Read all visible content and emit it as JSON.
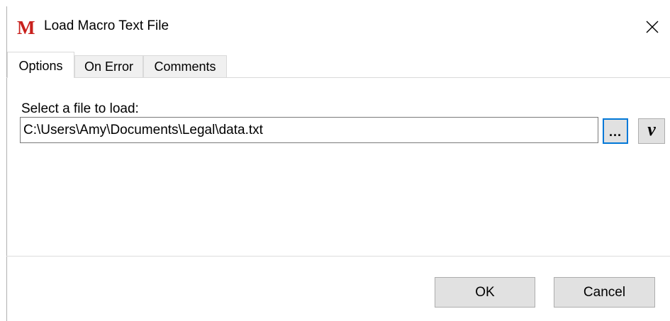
{
  "window": {
    "title": "Load Macro Text File",
    "icon": "macro-m-icon",
    "icon_letter": "M",
    "close_icon": "close-icon"
  },
  "tabs": [
    {
      "label": "Options",
      "active": true
    },
    {
      "label": "On Error",
      "active": false
    },
    {
      "label": "Comments",
      "active": false
    }
  ],
  "options": {
    "file_label": "Select a file to load:",
    "file_path": "C:\\Users\\Amy\\Documents\\Legal\\data.txt",
    "browse_label": "...",
    "variable_label": "v"
  },
  "footer": {
    "ok_label": "OK",
    "cancel_label": "Cancel"
  },
  "colors": {
    "accent": "#0078d7",
    "icon_red": "#c8201c",
    "button_bg": "#e1e1e1"
  }
}
